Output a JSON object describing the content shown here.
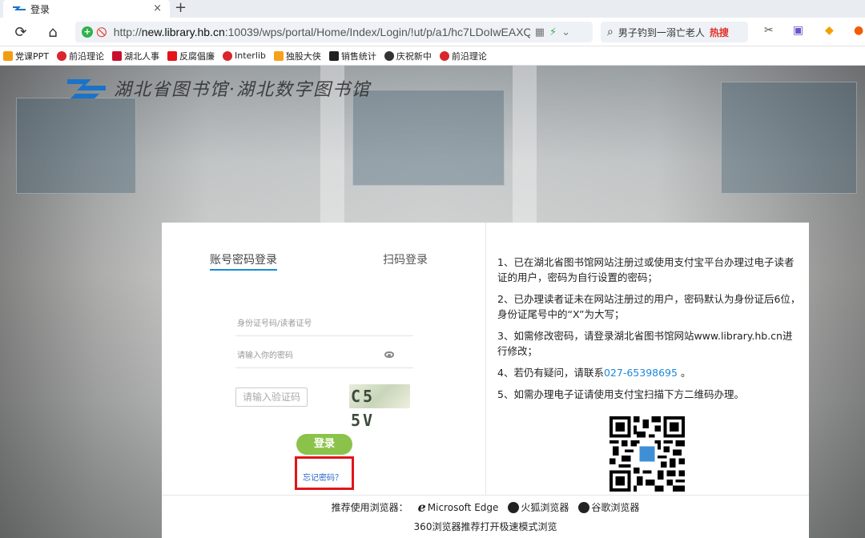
{
  "browser": {
    "tab_title": "登录",
    "tab_close": "×",
    "new_tab": "+",
    "url_prefix": "http://",
    "url_host": "new.library.hb.cn",
    "url_rest": ":10039/wps/portal/Home/Index/Login/!ut/p/a1/hc7LDoIwEAXQb",
    "search_text": "男子钓到一溺亡老人",
    "search_hot": "热搜",
    "bookmarks": [
      "党课PPT",
      "前沿理论",
      "湖北人事",
      "反腐倡廉",
      "Interlib",
      "独股大侠",
      "销售统计",
      "庆祝新中",
      "前沿理论"
    ]
  },
  "page": {
    "logo_text": "湖北省图书馆·湖北数字图书馆",
    "tabs": {
      "password": "账号密码登录",
      "scan": "扫码登录"
    },
    "fields": {
      "account_placeholder": "身份证号码/读者证号",
      "password_placeholder": "请输入你的密码",
      "captcha_placeholder": "请输入验证码",
      "captcha_text": "C5 5V"
    },
    "login_button": "登录",
    "forgot_link": "忘记密码？",
    "notes": [
      "1、已在湖北省图书馆网站注册过或使用支付宝平台办理过电子读者证的用户，密码为自行设置的密码；",
      "2、已办理读者证未在网站注册过的用户，密码默认为身份证后6位，身份证尾号中的“X”为大写；",
      "3、如需修改密码，请登录湖北省图书馆网站www.library.hb.cn进行修改；",
      "5、如需办理电子证请使用支付宝扫描下方二维码办理。"
    ],
    "note4_prefix": "4、若仍有疑问，请联系",
    "note4_phone": "027-65398695",
    "note4_suffix": " 。",
    "footer": {
      "recommend": "推荐使用浏览器：",
      "edge": "Microsoft Edge",
      "firefox": "火狐浏览器",
      "chrome": "谷歌浏览器",
      "line2": "360浏览器推荐打开极速模式浏览"
    }
  },
  "colors": {
    "accent_green": "#8bc34a",
    "link_blue": "#2a64c4",
    "highlight_red": "#e3141b"
  }
}
